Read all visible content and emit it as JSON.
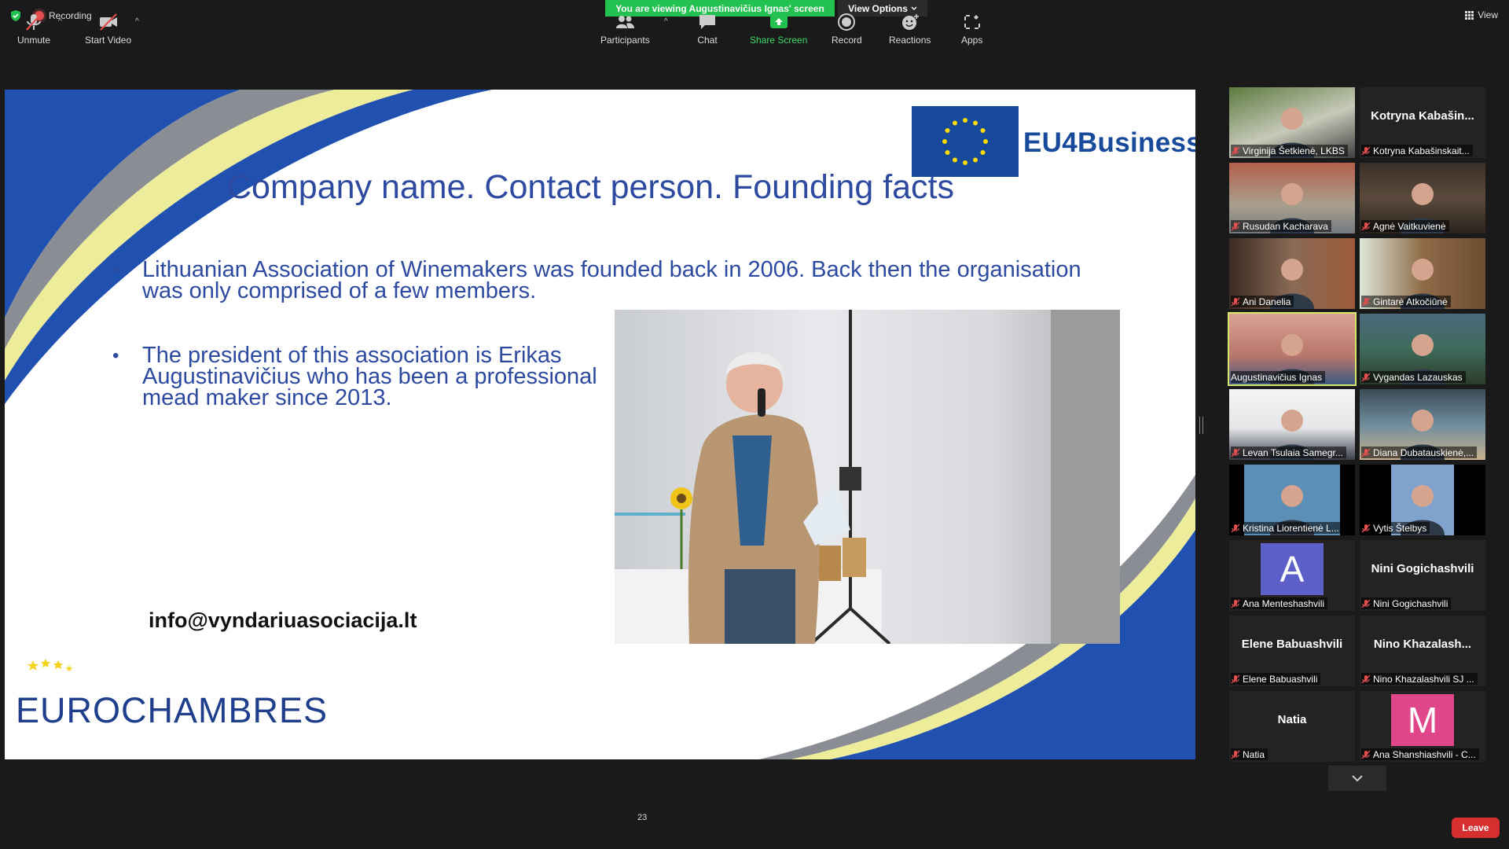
{
  "top_bar": {
    "recording_label": "Recording",
    "viewing_banner": "You are viewing Augustinavičius Ignas' screen",
    "view_options_label": "View Options",
    "view_label": "View"
  },
  "slide": {
    "brand_right": "EU4Business",
    "title": "Company name. Contact person. Founding facts",
    "bullets": [
      "Lithuanian Association of Winemakers was founded back in 2006. Back then the organisation was only comprised of a few members.",
      "The president of this association is Erikas Augustinavičius who has been a professional mead maker since 2013."
    ],
    "bullet_char": "•",
    "email": "info@vyndariuasociacija.lt",
    "logo_text": "EUROCHAMBRES"
  },
  "participants": [
    {
      "name": "Virginija Šetkienė, LKBS",
      "type": "video"
    },
    {
      "name": "Kotryna Kabašinskait...",
      "display": "Kotryna  Kabašin...",
      "type": "name"
    },
    {
      "name": "Rusudan Kacharava",
      "type": "video"
    },
    {
      "name": "Agnė Vaitkuvienė",
      "type": "video"
    },
    {
      "name": "Ani Danelia",
      "type": "video"
    },
    {
      "name": "Gintarė Atkočiūnė",
      "type": "video"
    },
    {
      "name": "Augustinavičius Ignas",
      "type": "video",
      "active": true
    },
    {
      "name": "Vygandas Lazauskas",
      "type": "video"
    },
    {
      "name": "Levan Tsulaia Samegr...",
      "type": "video"
    },
    {
      "name": "Diana Dubatauskienė,...",
      "type": "video"
    },
    {
      "name": "Kristina Liorentienė L...",
      "type": "video"
    },
    {
      "name": "Vytis Štelbys",
      "type": "video"
    },
    {
      "name": "Ana Menteshashvili",
      "type": "avatar",
      "letter": "A",
      "color": "#5b5fc7"
    },
    {
      "name": "Nini Gogichashvili",
      "display": "Nini Gogichashvili",
      "type": "name"
    },
    {
      "name": "Elene Babuashvili",
      "display": "Elene Babuashvili",
      "type": "name"
    },
    {
      "name": "Nino Khazalashvili SJ ...",
      "display": "Nino  Khazalash...",
      "type": "name"
    },
    {
      "name": "Natia",
      "display": "Natia",
      "type": "name"
    },
    {
      "name": "Ana Shanshiashvili - C...",
      "type": "avatar",
      "letter": "M",
      "color": "#e0468a"
    }
  ],
  "toolbar": {
    "unmute": "Unmute",
    "start_video": "Start Video",
    "participants": "Participants",
    "participants_count": "23",
    "chat": "Chat",
    "share_screen": "Share Screen",
    "record": "Record",
    "reactions": "Reactions",
    "apps": "Apps",
    "leave": "Leave"
  },
  "colors": {
    "banner_green": "#23c150",
    "leave_red": "#d62f2f",
    "active_speaker": "#d6e66b",
    "slide_blue": "#2d4aa0"
  }
}
